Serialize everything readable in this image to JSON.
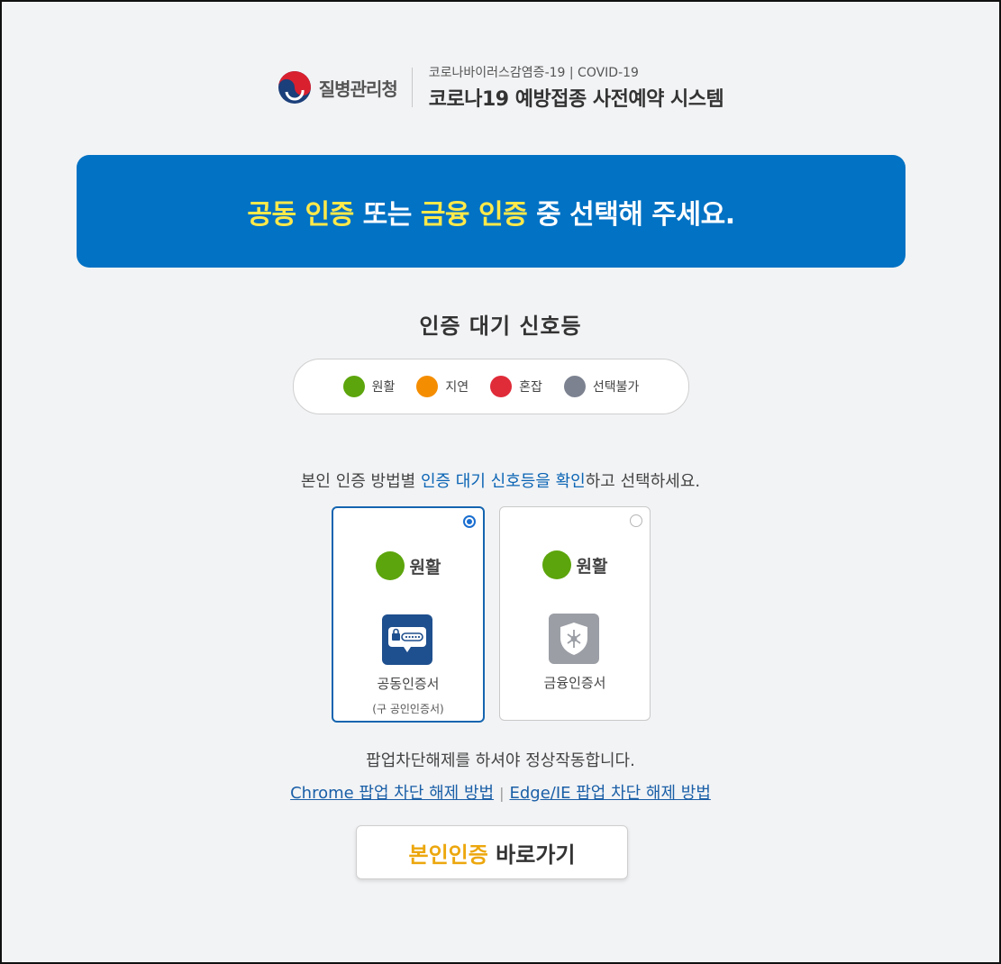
{
  "header": {
    "org_name": "질병관리청",
    "subtitle": "코로나바이러스감염증-19 | COVID-19",
    "title": "코로나19 예방접종 사전예약 시스템"
  },
  "banner": {
    "part1": "공동 인증",
    "part2": " 또는 ",
    "part3": "금융 인증",
    "part4": " 중 선택해 주세요."
  },
  "signal": {
    "title": "인증 대기 신호등",
    "legend": [
      {
        "label": "원활",
        "color": "#5ca50c"
      },
      {
        "label": "지연",
        "color": "#f58d00"
      },
      {
        "label": "혼잡",
        "color": "#e02b39"
      },
      {
        "label": "선택불가",
        "color": "#7c8290"
      }
    ]
  },
  "instruction": {
    "part1": "본인 인증 방법별 ",
    "part2": "인증 대기 신호등을 확인",
    "part3": "하고 선택하세요."
  },
  "cards": [
    {
      "status": "원활",
      "name": "공동인증서",
      "note": "(구 공인인증서)",
      "selected": true,
      "icon": "certificate-lock-icon"
    },
    {
      "status": "원활",
      "name": "금융인증서",
      "note": "",
      "selected": false,
      "icon": "shield-key-icon"
    }
  ],
  "popup": {
    "note": "팝업차단해제를 하셔야 정상작동합니다.",
    "chrome_link": "Chrome 팝업 차단 해제 방법",
    "separator": "|",
    "edge_link": "Edge/IE 팝업 차단 해제 방법"
  },
  "go_button": {
    "highlight": "본인인증",
    "rest": " 바로가기"
  }
}
